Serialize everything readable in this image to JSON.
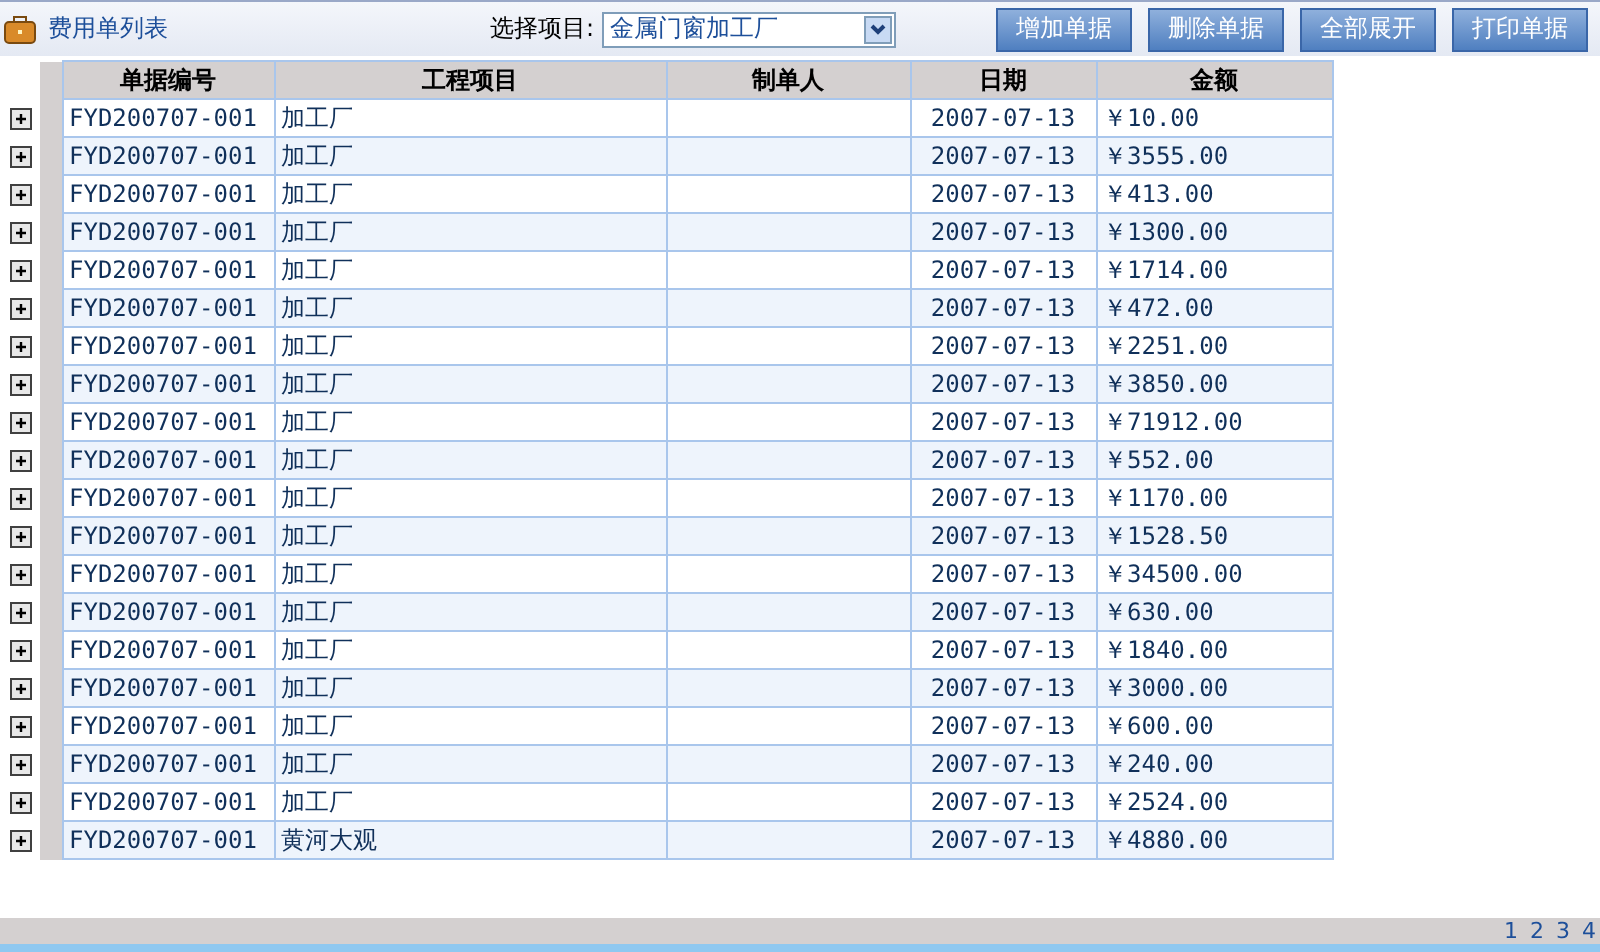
{
  "header": {
    "title": "费用单列表",
    "project_label": "选择项目:",
    "project_value": "金属门窗加工厂",
    "buttons": [
      "增加单据",
      "删除单据",
      "全部展开",
      "打印单据"
    ]
  },
  "table": {
    "columns": [
      "单据编号",
      "工程项目",
      "制单人",
      "日期",
      "金额"
    ],
    "rows": [
      {
        "expanded": false,
        "cells": [
          "FYD200707-001",
          "加工厂",
          "",
          "2007-07-13",
          "￥10.00"
        ]
      },
      {
        "expanded": false,
        "cells": [
          "FYD200707-001",
          "加工厂",
          "",
          "2007-07-13",
          "￥3555.00"
        ]
      },
      {
        "expanded": false,
        "cells": [
          "FYD200707-001",
          "加工厂",
          "",
          "2007-07-13",
          "￥413.00"
        ]
      },
      {
        "expanded": false,
        "cells": [
          "FYD200707-001",
          "加工厂",
          "",
          "2007-07-13",
          "￥1300.00"
        ]
      },
      {
        "expanded": false,
        "cells": [
          "FYD200707-001",
          "加工厂",
          "",
          "2007-07-13",
          "￥1714.00"
        ]
      },
      {
        "expanded": false,
        "cells": [
          "FYD200707-001",
          "加工厂",
          "",
          "2007-07-13",
          "￥472.00"
        ]
      },
      {
        "expanded": false,
        "cells": [
          "FYD200707-001",
          "加工厂",
          "",
          "2007-07-13",
          "￥2251.00"
        ]
      },
      {
        "expanded": false,
        "cells": [
          "FYD200707-001",
          "加工厂",
          "",
          "2007-07-13",
          "￥3850.00"
        ]
      },
      {
        "expanded": false,
        "cells": [
          "FYD200707-001",
          "加工厂",
          "",
          "2007-07-13",
          "￥71912.00"
        ]
      },
      {
        "expanded": false,
        "cells": [
          "FYD200707-001",
          "加工厂",
          "",
          "2007-07-13",
          "￥552.00"
        ]
      },
      {
        "expanded": false,
        "cells": [
          "FYD200707-001",
          "加工厂",
          "",
          "2007-07-13",
          "￥1170.00"
        ]
      },
      {
        "expanded": false,
        "cells": [
          "FYD200707-001",
          "加工厂",
          "",
          "2007-07-13",
          "￥1528.50"
        ]
      },
      {
        "expanded": false,
        "cells": [
          "FYD200707-001",
          "加工厂",
          "",
          "2007-07-13",
          "￥34500.00"
        ]
      },
      {
        "expanded": false,
        "cells": [
          "FYD200707-001",
          "加工厂",
          "",
          "2007-07-13",
          "￥630.00"
        ]
      },
      {
        "expanded": false,
        "cells": [
          "FYD200707-001",
          "加工厂",
          "",
          "2007-07-13",
          "￥1840.00"
        ]
      },
      {
        "expanded": false,
        "cells": [
          "FYD200707-001",
          "加工厂",
          "",
          "2007-07-13",
          "￥3000.00"
        ]
      },
      {
        "expanded": false,
        "cells": [
          "FYD200707-001",
          "加工厂",
          "",
          "2007-07-13",
          "￥600.00"
        ]
      },
      {
        "expanded": false,
        "cells": [
          "FYD200707-001",
          "加工厂",
          "",
          "2007-07-13",
          "￥240.00"
        ]
      },
      {
        "expanded": false,
        "cells": [
          "FYD200707-001",
          "加工厂",
          "",
          "2007-07-13",
          "￥2524.00"
        ]
      },
      {
        "expanded": false,
        "cells": [
          "FYD200707-001",
          "黄河大观",
          "",
          "2007-07-13",
          "￥4880.00"
        ]
      }
    ]
  },
  "pagination": [
    "1",
    "2",
    "3",
    "4"
  ]
}
